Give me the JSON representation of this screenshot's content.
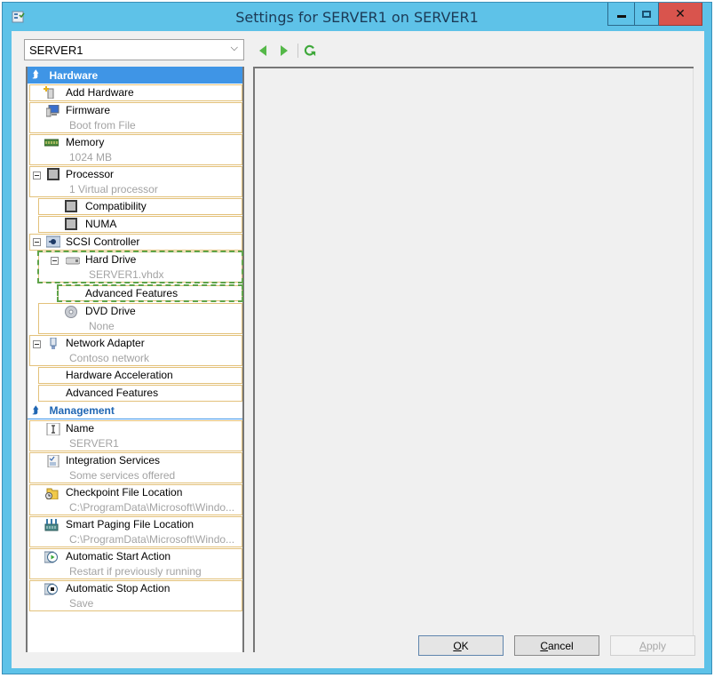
{
  "window": {
    "title": "Settings for SERVER1 on SERVER1",
    "controls": {
      "minimize": "minimize",
      "maximize": "maximize",
      "close": "✕"
    }
  },
  "vm_selector": {
    "value": "SERVER1"
  },
  "toolbar": {
    "back": "back-icon",
    "forward": "forward-icon",
    "refresh": "refresh-icon"
  },
  "sections": {
    "hardware": {
      "label": "Hardware"
    },
    "management": {
      "label": "Management"
    }
  },
  "hardware_items": {
    "add_hardware": {
      "name": "Add Hardware"
    },
    "firmware": {
      "name": "Firmware",
      "sub": "Boot from File"
    },
    "memory": {
      "name": "Memory",
      "sub": "1024 MB"
    },
    "processor": {
      "name": "Processor",
      "sub": "1 Virtual processor"
    },
    "compatibility": {
      "name": "Compatibility"
    },
    "numa": {
      "name": "NUMA"
    },
    "scsi": {
      "name": "SCSI Controller"
    },
    "hard_drive": {
      "name": "Hard Drive",
      "sub": "SERVER1.vhdx"
    },
    "hd_advanced": {
      "name": "Advanced Features"
    },
    "dvd": {
      "name": "DVD Drive",
      "sub": "None"
    },
    "network": {
      "name": "Network Adapter",
      "sub": "Contoso network"
    },
    "hw_accel": {
      "name": "Hardware Acceleration"
    },
    "net_advanced": {
      "name": "Advanced Features"
    }
  },
  "management_items": {
    "name": {
      "name": "Name",
      "sub": "SERVER1"
    },
    "integration": {
      "name": "Integration Services",
      "sub": "Some services offered"
    },
    "checkpoint": {
      "name": "Checkpoint File Location",
      "sub": "C:\\ProgramData\\Microsoft\\Windo..."
    },
    "smart_paging": {
      "name": "Smart Paging File Location",
      "sub": "C:\\ProgramData\\Microsoft\\Windo..."
    },
    "auto_start": {
      "name": "Automatic Start Action",
      "sub": "Restart if previously running"
    },
    "auto_stop": {
      "name": "Automatic Stop Action",
      "sub": "Save"
    }
  },
  "buttons": {
    "ok": {
      "accel": "O",
      "rest": "K"
    },
    "cancel": {
      "accel": "C",
      "rest": "ancel"
    },
    "apply": {
      "accel": "A",
      "rest": "pply"
    }
  },
  "colors": {
    "title_bar": "#5ec2e8",
    "selection_header": "#3f95e6",
    "item_border": "#e3c17a",
    "highlight_dash": "#5fa349",
    "close_button": "#d9544d"
  }
}
